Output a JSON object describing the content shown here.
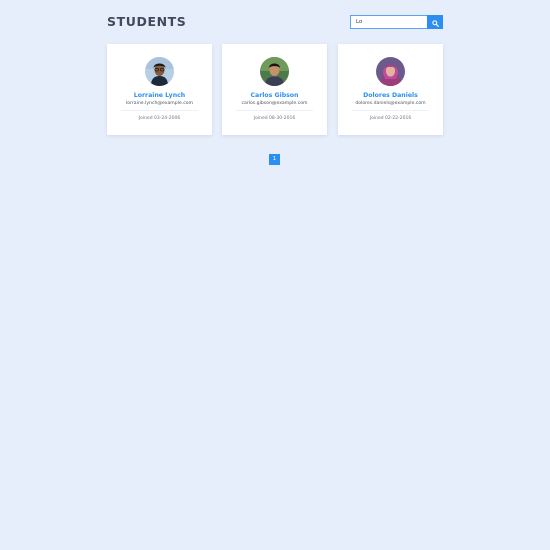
{
  "page": {
    "title": "STUDENTS"
  },
  "search": {
    "value": "Lo",
    "button_icon": "search-icon"
  },
  "colors": {
    "background": "#e6eefb",
    "accent": "#2b8ff2",
    "title": "#3f4a5c"
  },
  "students": [
    {
      "name": "Lorraine Lynch",
      "email": "lorraine.lynch@example.com",
      "joined": "Joined 03-24-2006",
      "avatar": "avatar-photo"
    },
    {
      "name": "Carlos Gibson",
      "email": "carlos.gibson@example.com",
      "joined": "Joined 08-30-2016",
      "avatar": "avatar-photo"
    },
    {
      "name": "Dolores Daniels",
      "email": "dolores.daniels@example.com",
      "joined": "Joined 02-22-2016",
      "avatar": "avatar-photo"
    }
  ],
  "pagination": {
    "pages": [
      "1"
    ],
    "current": "1"
  }
}
